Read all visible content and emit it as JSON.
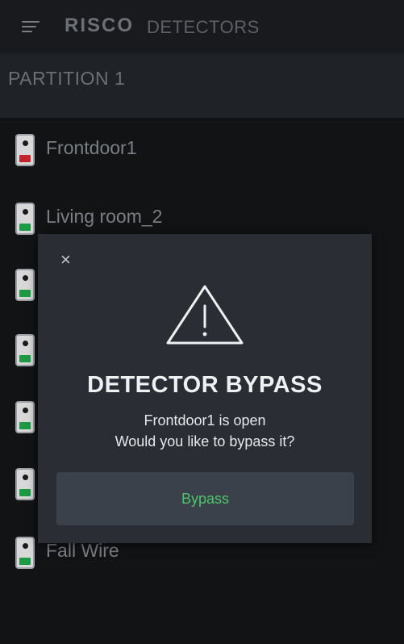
{
  "header": {
    "brand": "RISCO",
    "title": "DETECTORS"
  },
  "partition": {
    "label": "PARTITION 1"
  },
  "detectors": [
    {
      "name": "Frontdoor1",
      "status_color": "#c0262c"
    },
    {
      "name": "Living room_2",
      "status_color": "#1e9a45"
    },
    {
      "name": "",
      "status_color": "#1e9a45"
    },
    {
      "name": "",
      "status_color": "#1e9a45"
    },
    {
      "name": "",
      "status_color": "#1e9a45"
    },
    {
      "name": "",
      "status_color": "#1e9a45"
    },
    {
      "name": "Fall Wire",
      "status_color": "#1e9a45"
    }
  ],
  "modal": {
    "close_symbol": "×",
    "title": "DETECTOR BYPASS",
    "line1": "Frontdoor1 is open",
    "line2": "Would you like to bypass it?",
    "bypass_label": "Bypass"
  },
  "colors": {
    "open_red": "#c0262c",
    "ok_green": "#1e9a45",
    "button_text_green": "#4cc46a"
  }
}
